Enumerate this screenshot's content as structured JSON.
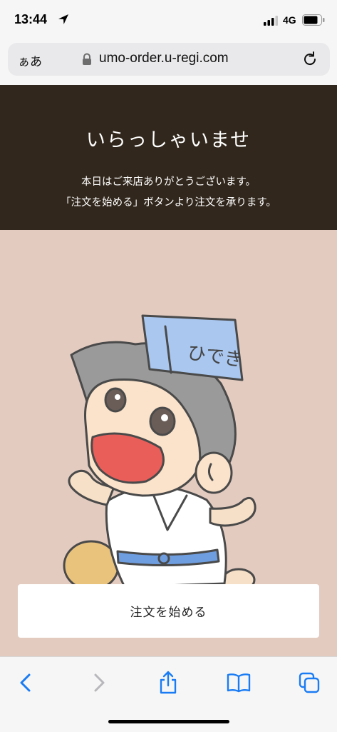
{
  "status_bar": {
    "time": "13:44",
    "network": "4G",
    "icons": [
      "location-arrow-icon",
      "signal-bars-icon",
      "battery-icon"
    ]
  },
  "browser": {
    "text_size_label": "ぁあ",
    "url": "umo-order.u-regi.com",
    "icons": [
      "lock-icon",
      "reload-icon"
    ]
  },
  "hero": {
    "title": "いらっしゃいませ",
    "line1": "本日はご来店ありがとうございます。",
    "line2": "「注文を始める」ボタンより注文を承ります。",
    "background": "#31271c"
  },
  "illustration": {
    "background": "#e3cbc0",
    "hat_text": "ひでき"
  },
  "start_button": {
    "label": "注文を始める"
  },
  "toolbar": {
    "accent": "#1a7cf4",
    "icons": [
      "back-icon",
      "forward-icon",
      "share-icon",
      "bookmarks-icon",
      "tabs-icon"
    ]
  }
}
